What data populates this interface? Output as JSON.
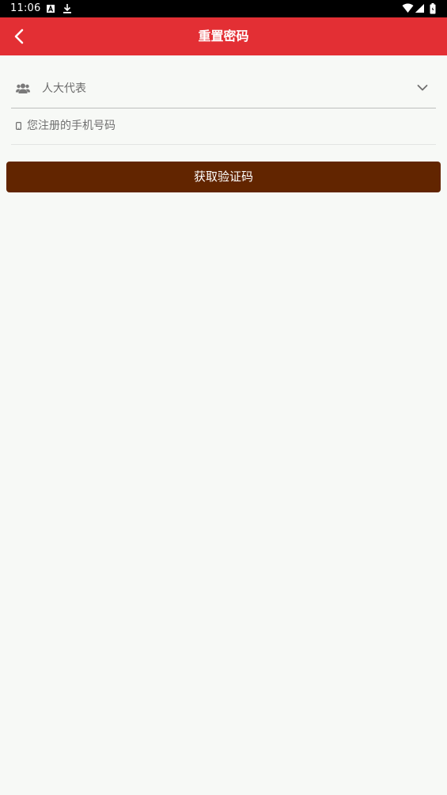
{
  "status_bar": {
    "time": "11:06",
    "left_icons": [
      "notification-a-icon",
      "download-icon"
    ],
    "right_icons": [
      "wifi-icon",
      "signal-icon",
      "battery-icon"
    ]
  },
  "header": {
    "title": "重置密码",
    "back_icon": "chevron-left-icon",
    "background_color": "#e32f34"
  },
  "form": {
    "role": {
      "icon": "users-icon",
      "selected_value": "人大代表",
      "dropdown_icon": "chevron-down-icon"
    },
    "phone": {
      "icon": "mobile-icon",
      "value": "",
      "placeholder": "您注册的手机号码"
    },
    "submit_label": "获取验证码",
    "submit_color": "#622500"
  }
}
